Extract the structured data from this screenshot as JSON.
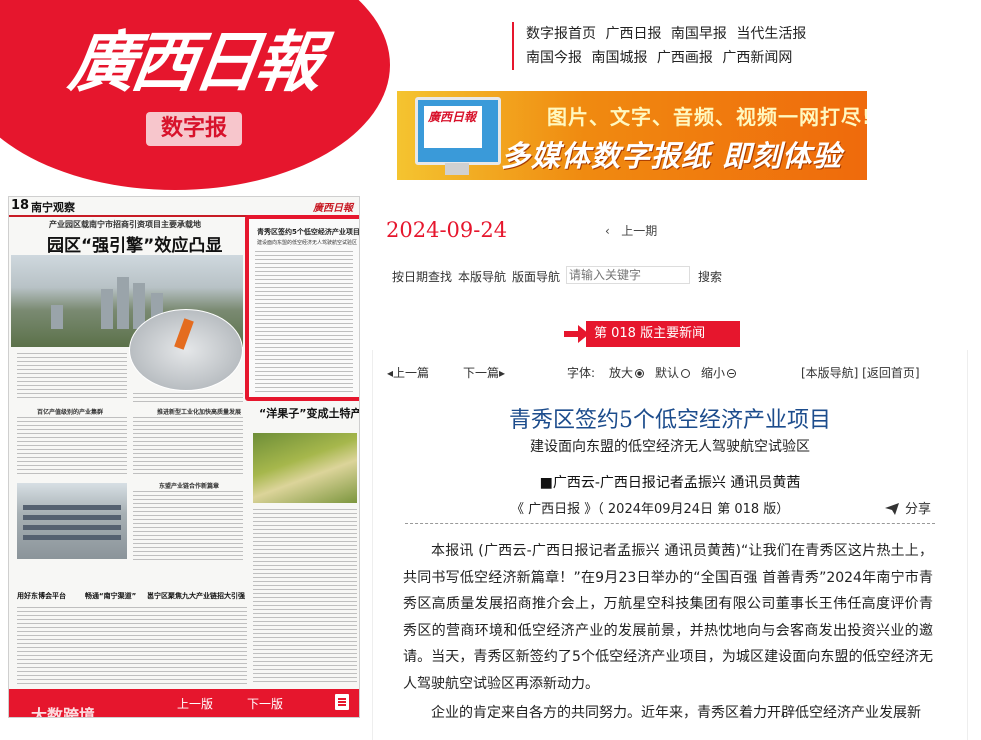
{
  "header": {
    "logo_title": "廣西日報",
    "logo_subtitle": "数字报",
    "nav_row1": [
      "数字报首页",
      "广西日报",
      "南国早报",
      "当代生活报"
    ],
    "nav_row2": [
      "南国今报",
      "南国城报",
      "广西画报",
      "广西新闻网"
    ],
    "banner_line1": "图片、文字、音频、视频一网打尽!",
    "banner_line2": "多媒体数字报纸 即刻体验",
    "banner_mini": "廣西日報"
  },
  "paper": {
    "page_number": "18",
    "section": "南宁观察",
    "masthead": "廣西日報",
    "kicker": "产业园区载南宁市招商引资项目主要承载地",
    "headline": "园区“强引擎”效应凸显",
    "highlight_title": "青秀区签约5个低空经济产业项目",
    "highlight_sub": "建设面向东盟的低空经济无人驾驶航空试验区",
    "headline2": "“洋果子”变成土特产",
    "mini_heads": [
      "百亿产值级别的产业集群",
      "推进新型工业化加快高质量发展",
      "东盟产业链合作新篇章"
    ],
    "bottom_heads": [
      "用好东博会平台",
      "畅通“南宁渠道”",
      "邕宁区聚焦九大产业链招大引强"
    ],
    "toolbar": {
      "prev": "上一版",
      "next": "下一版"
    },
    "watermark": "大数跨境"
  },
  "issue": {
    "date": "2024-09-24",
    "prev_issue": "上一期"
  },
  "search": {
    "by_date": "按日期查找",
    "edition_nav": "本版导航",
    "page_nav": "版面导航",
    "placeholder": "请输入关键字",
    "button": "搜索"
  },
  "section_tag": "第 018 版主要新闻",
  "article_toolbar": {
    "prev": "上一篇",
    "next": "下一篇",
    "font_label": "字体:",
    "font_large": "放大",
    "font_default": "默认",
    "font_small": "缩小",
    "links": "[本版导航] [返回首页]"
  },
  "article": {
    "title": "青秀区签约5个低空经济产业项目",
    "subtitle": "建设面向东盟的低空经济无人驾驶航空试验区",
    "author": "■广西云-广西日报记者孟振兴 通讯员黄茜",
    "source": "《 广西日报 》（ 2024年09月24日 第 018 版）",
    "share": "分享",
    "paragraphs": [
      "本报讯 (广西云-广西日报记者孟振兴 通讯员黄茜)“让我们在青秀区这片热土上，共同书写低空经济新篇章！”在9月23日举办的“全国百强 首善青秀”2024年南宁市青秀区高质量发展招商推介会上，万航星空科技集团有限公司董事长王伟任高度评价青秀区的营商环境和低空经济产业的发展前景，并热忱地向与会客商发出投资兴业的邀请。当天，青秀区新签约了5个低空经济产业项目，为城区建设面向东盟的低空经济无人驾驶航空试验区再添新动力。",
      "企业的肯定来自各方的共同努力。近年来，青秀区着力开辟低空经济产业发展新"
    ]
  }
}
